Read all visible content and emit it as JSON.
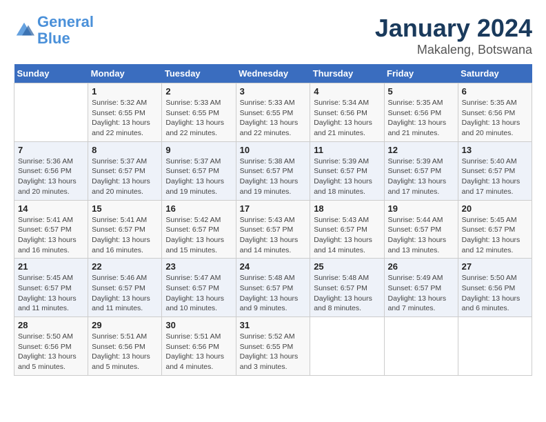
{
  "header": {
    "logo_line1": "General",
    "logo_line2": "Blue",
    "title": "January 2024",
    "subtitle": "Makaleng, Botswana"
  },
  "weekdays": [
    "Sunday",
    "Monday",
    "Tuesday",
    "Wednesday",
    "Thursday",
    "Friday",
    "Saturday"
  ],
  "weeks": [
    [
      {
        "day": "",
        "info": ""
      },
      {
        "day": "1",
        "info": "Sunrise: 5:32 AM\nSunset: 6:55 PM\nDaylight: 13 hours\nand 22 minutes."
      },
      {
        "day": "2",
        "info": "Sunrise: 5:33 AM\nSunset: 6:55 PM\nDaylight: 13 hours\nand 22 minutes."
      },
      {
        "day": "3",
        "info": "Sunrise: 5:33 AM\nSunset: 6:55 PM\nDaylight: 13 hours\nand 22 minutes."
      },
      {
        "day": "4",
        "info": "Sunrise: 5:34 AM\nSunset: 6:56 PM\nDaylight: 13 hours\nand 21 minutes."
      },
      {
        "day": "5",
        "info": "Sunrise: 5:35 AM\nSunset: 6:56 PM\nDaylight: 13 hours\nand 21 minutes."
      },
      {
        "day": "6",
        "info": "Sunrise: 5:35 AM\nSunset: 6:56 PM\nDaylight: 13 hours\nand 20 minutes."
      }
    ],
    [
      {
        "day": "7",
        "info": "Sunrise: 5:36 AM\nSunset: 6:56 PM\nDaylight: 13 hours\nand 20 minutes."
      },
      {
        "day": "8",
        "info": "Sunrise: 5:37 AM\nSunset: 6:57 PM\nDaylight: 13 hours\nand 20 minutes."
      },
      {
        "day": "9",
        "info": "Sunrise: 5:37 AM\nSunset: 6:57 PM\nDaylight: 13 hours\nand 19 minutes."
      },
      {
        "day": "10",
        "info": "Sunrise: 5:38 AM\nSunset: 6:57 PM\nDaylight: 13 hours\nand 19 minutes."
      },
      {
        "day": "11",
        "info": "Sunrise: 5:39 AM\nSunset: 6:57 PM\nDaylight: 13 hours\nand 18 minutes."
      },
      {
        "day": "12",
        "info": "Sunrise: 5:39 AM\nSunset: 6:57 PM\nDaylight: 13 hours\nand 17 minutes."
      },
      {
        "day": "13",
        "info": "Sunrise: 5:40 AM\nSunset: 6:57 PM\nDaylight: 13 hours\nand 17 minutes."
      }
    ],
    [
      {
        "day": "14",
        "info": "Sunrise: 5:41 AM\nSunset: 6:57 PM\nDaylight: 13 hours\nand 16 minutes."
      },
      {
        "day": "15",
        "info": "Sunrise: 5:41 AM\nSunset: 6:57 PM\nDaylight: 13 hours\nand 16 minutes."
      },
      {
        "day": "16",
        "info": "Sunrise: 5:42 AM\nSunset: 6:57 PM\nDaylight: 13 hours\nand 15 minutes."
      },
      {
        "day": "17",
        "info": "Sunrise: 5:43 AM\nSunset: 6:57 PM\nDaylight: 13 hours\nand 14 minutes."
      },
      {
        "day": "18",
        "info": "Sunrise: 5:43 AM\nSunset: 6:57 PM\nDaylight: 13 hours\nand 14 minutes."
      },
      {
        "day": "19",
        "info": "Sunrise: 5:44 AM\nSunset: 6:57 PM\nDaylight: 13 hours\nand 13 minutes."
      },
      {
        "day": "20",
        "info": "Sunrise: 5:45 AM\nSunset: 6:57 PM\nDaylight: 13 hours\nand 12 minutes."
      }
    ],
    [
      {
        "day": "21",
        "info": "Sunrise: 5:45 AM\nSunset: 6:57 PM\nDaylight: 13 hours\nand 11 minutes."
      },
      {
        "day": "22",
        "info": "Sunrise: 5:46 AM\nSunset: 6:57 PM\nDaylight: 13 hours\nand 11 minutes."
      },
      {
        "day": "23",
        "info": "Sunrise: 5:47 AM\nSunset: 6:57 PM\nDaylight: 13 hours\nand 10 minutes."
      },
      {
        "day": "24",
        "info": "Sunrise: 5:48 AM\nSunset: 6:57 PM\nDaylight: 13 hours\nand 9 minutes."
      },
      {
        "day": "25",
        "info": "Sunrise: 5:48 AM\nSunset: 6:57 PM\nDaylight: 13 hours\nand 8 minutes."
      },
      {
        "day": "26",
        "info": "Sunrise: 5:49 AM\nSunset: 6:57 PM\nDaylight: 13 hours\nand 7 minutes."
      },
      {
        "day": "27",
        "info": "Sunrise: 5:50 AM\nSunset: 6:56 PM\nDaylight: 13 hours\nand 6 minutes."
      }
    ],
    [
      {
        "day": "28",
        "info": "Sunrise: 5:50 AM\nSunset: 6:56 PM\nDaylight: 13 hours\nand 5 minutes."
      },
      {
        "day": "29",
        "info": "Sunrise: 5:51 AM\nSunset: 6:56 PM\nDaylight: 13 hours\nand 5 minutes."
      },
      {
        "day": "30",
        "info": "Sunrise: 5:51 AM\nSunset: 6:56 PM\nDaylight: 13 hours\nand 4 minutes."
      },
      {
        "day": "31",
        "info": "Sunrise: 5:52 AM\nSunset: 6:55 PM\nDaylight: 13 hours\nand 3 minutes."
      },
      {
        "day": "",
        "info": ""
      },
      {
        "day": "",
        "info": ""
      },
      {
        "day": "",
        "info": ""
      }
    ]
  ]
}
